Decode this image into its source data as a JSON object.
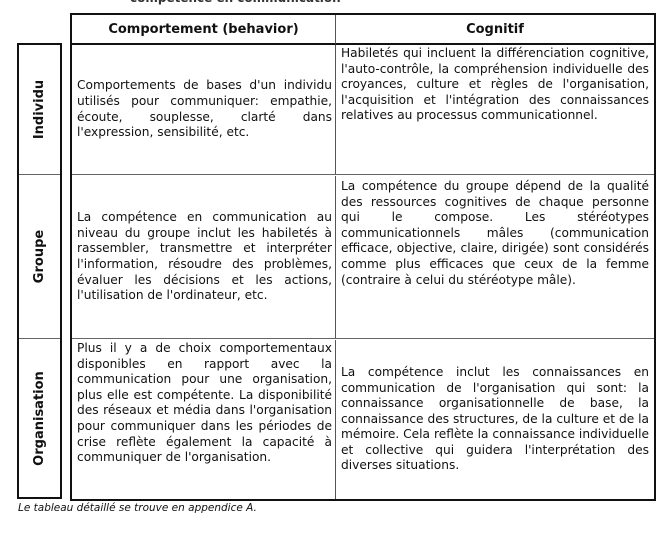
{
  "document": {
    "cut_title": "compétence en communication",
    "table": {
      "headers": [
        "Comportement (behavior)",
        "Cognitif"
      ],
      "rows": [
        {
          "label": "Individu",
          "behavior": "Comportements de bases d'un individu utilisés pour communiquer: empathie, écoute, souplesse, clarté dans l'expression, sensibilité, etc.",
          "cognitive": "Habiletés qui incluent la différenciation cognitive, l'auto-contrôle, la compréhension individuelle des croyances, culture et règles de l'organisation, l'acquisition et l'intégration des connaissances relatives au processus communicationnel."
        },
        {
          "label": "Groupe",
          "behavior": "La compétence en communication au niveau du groupe inclut les habiletés à rassembler, transmettre et interpréter l'information, résoudre des problèmes, évaluer les décisions et les actions, l'utilisation de l'ordinateur, etc.",
          "cognitive": "La compétence du groupe dépend de la qualité des ressources cognitives de chaque personne qui le compose. Les stéréotypes communicationnels mâles (communication efficace, objective, claire, dirigée) sont considérés comme plus efficaces que ceux de la femme (contraire à celui du stéréotype mâle)."
        },
        {
          "label": "Organisation",
          "behavior": "Plus il y a de choix comportementaux disponibles en rapport avec la communication pour une organisation, plus elle est compétente. La disponibilité des réseaux et média dans l'organisation pour communiquer dans les périodes de crise reflète également la capacité à communiquer de l'organisation.",
          "cognitive": "La compétence inclut les connaissances en communication de l'organisation qui sont: la connaissance organisationnelle de base, la connaissance des structures, de la culture et de la mémoire. Cela reflète la connaissance individuelle et collective qui guidera l'interprétation des diverses situations."
        }
      ]
    },
    "caption": "Le tableau détaillé se trouve en appendice A."
  }
}
